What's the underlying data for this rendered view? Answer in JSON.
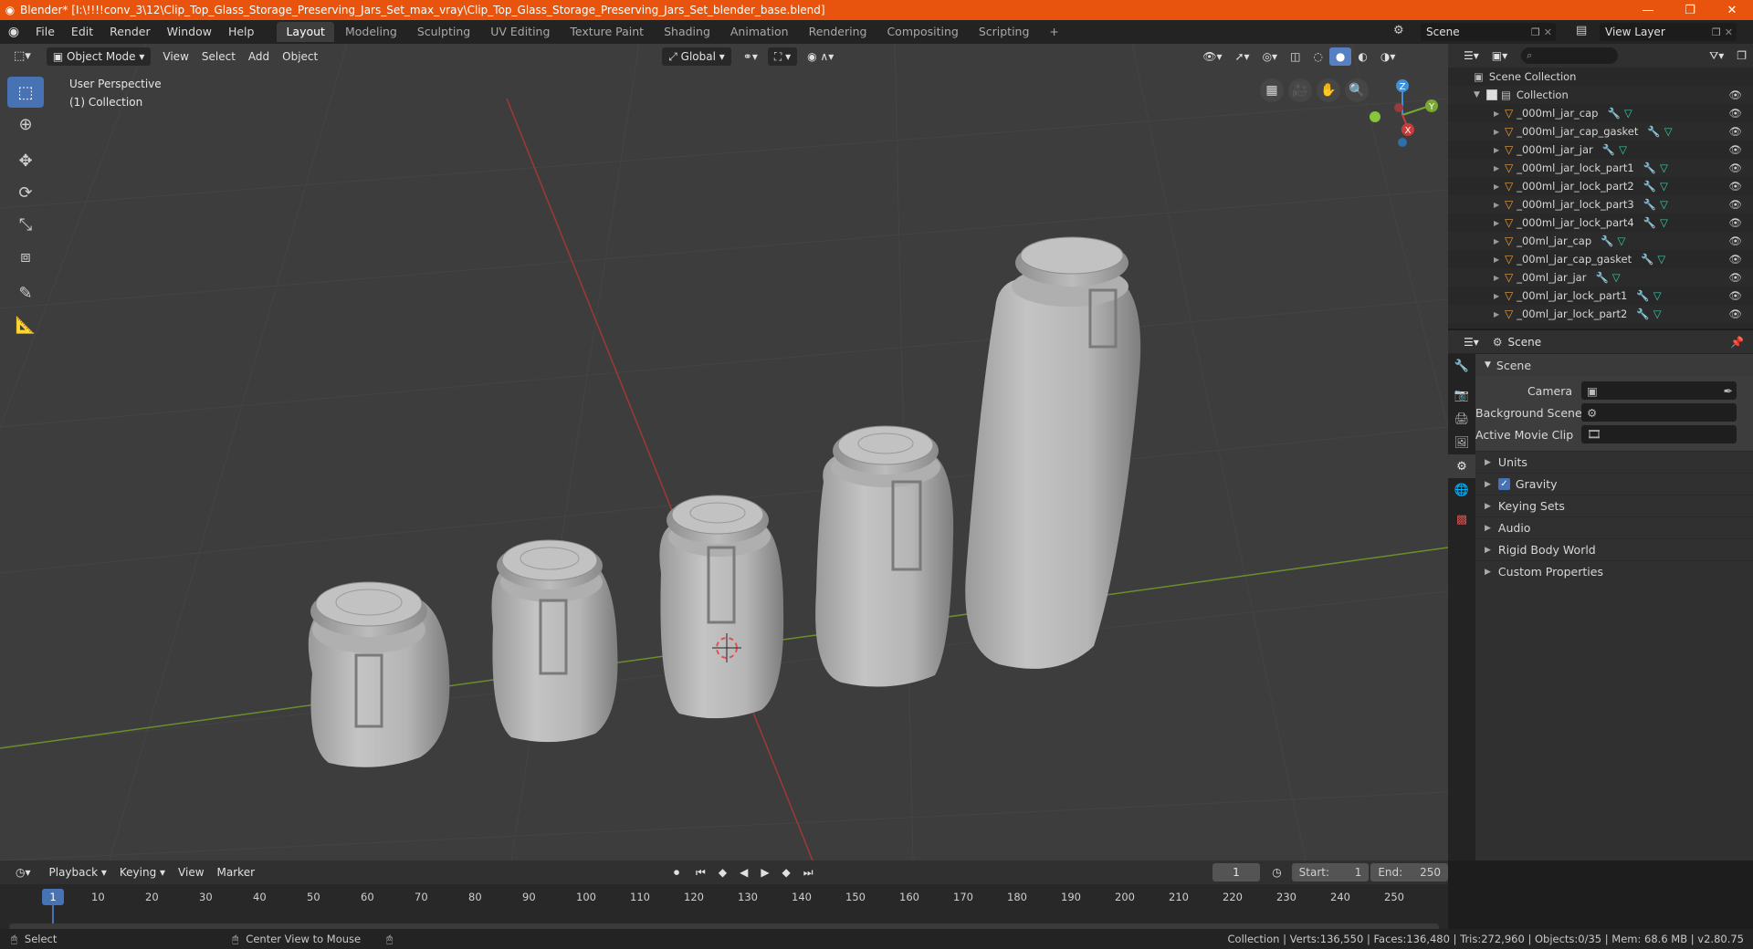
{
  "window": {
    "title": "Blender* [I:\\!!!!conv_3\\12\\Clip_Top_Glass_Storage_Preserving_Jars_Set_max_vray\\Clip_Top_Glass_Storage_Preserving_Jars_Set_blender_base.blend]",
    "controls": [
      "—",
      "❐",
      "✕"
    ]
  },
  "menu": [
    "File",
    "Edit",
    "Render",
    "Window",
    "Help"
  ],
  "workspaces": [
    "Layout",
    "Modeling",
    "Sculpting",
    "UV Editing",
    "Texture Paint",
    "Shading",
    "Animation",
    "Rendering",
    "Compositing",
    "Scripting"
  ],
  "active_workspace": "Layout",
  "add_workspace": "+",
  "scene_selector": "Scene",
  "view_layer_selector": "View Layer",
  "viewport": {
    "mode": "Object Mode",
    "menus": [
      "View",
      "Select",
      "Add",
      "Object"
    ],
    "transform_orientation": "Global",
    "info_line1": "User Perspective",
    "info_line2": "(1) Collection",
    "gizmo_labels": [
      "Z",
      "Y",
      "X"
    ]
  },
  "outliner": {
    "root": "Scene Collection",
    "collection": "Collection",
    "items": [
      "_000ml_jar_cap",
      "_000ml_jar_cap_gasket",
      "_000ml_jar_jar",
      "_000ml_jar_lock_part1",
      "_000ml_jar_lock_part2",
      "_000ml_jar_lock_part3",
      "_000ml_jar_lock_part4",
      "_00ml_jar_cap",
      "_00ml_jar_cap_gasket",
      "_00ml_jar_jar",
      "_00ml_jar_lock_part1",
      "_00ml_jar_lock_part2"
    ]
  },
  "properties": {
    "context_label": "Scene",
    "panel_title": "Scene",
    "fields": [
      {
        "label": "Camera"
      },
      {
        "label": "Background Scene"
      },
      {
        "label": "Active Movie Clip"
      }
    ],
    "sections": [
      "Units",
      "Gravity",
      "Keying Sets",
      "Audio",
      "Rigid Body World",
      "Custom Properties"
    ],
    "gravity_checked": true
  },
  "timeline": {
    "menus": [
      "Playback",
      "Keying",
      "View",
      "Marker"
    ],
    "current_frame": "1",
    "start_label": "Start:",
    "start_value": "1",
    "end_label": "End:",
    "end_value": "250",
    "ruler_current": "1",
    "ruler_ticks": [
      "10",
      "20",
      "30",
      "40",
      "50",
      "60",
      "70",
      "80",
      "90",
      "100",
      "110",
      "120",
      "130",
      "140",
      "150",
      "160",
      "170",
      "180",
      "190",
      "200",
      "210",
      "220",
      "230",
      "240",
      "250"
    ]
  },
  "status": {
    "left_action": "Select",
    "middle_action": "Center View to Mouse",
    "stats": "Collection | Verts:136,550 | Faces:136,480 | Tris:272,960 | Objects:0/35 | Mem: 68.6 MB | v2.80.75"
  },
  "colors": {
    "title_bar": "#e8540d",
    "active_tool": "#4772b3",
    "x_axis": "#c83c3c",
    "y_axis": "#7aa634",
    "z_axis": "#3f8fdb"
  }
}
